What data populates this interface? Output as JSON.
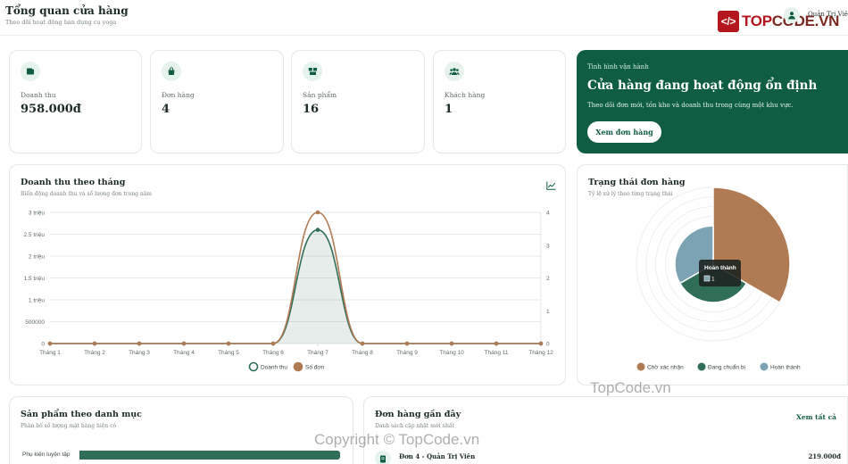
{
  "header": {
    "title": "Tổng quan cửa hàng",
    "subtitle": "Theo dõi hoạt động bán dụng cụ yoga",
    "user_name": "Quản Trị Viên"
  },
  "logo": {
    "top": "TOP",
    "code": "CODE",
    "vn": ".VN"
  },
  "stats": [
    {
      "label": "Doanh thu",
      "value": "958.000đ",
      "icon": "wallet-icon"
    },
    {
      "label": "Đơn hàng",
      "value": "4",
      "icon": "shopping-bag-icon"
    },
    {
      "label": "Sản phẩm",
      "value": "16",
      "icon": "boxes-icon"
    },
    {
      "label": "Khách hàng",
      "value": "1",
      "icon": "users-icon"
    }
  ],
  "banner": {
    "kicker": "Tình hình vận hành",
    "title": "Cửa hàng đang hoạt động ổn định",
    "description": "Theo dõi đơn mới, tồn kho và doanh thu trong cùng một khu vực.",
    "button": "Xem đơn hàng"
  },
  "revenue_panel": {
    "title": "Doanh thu theo tháng",
    "subtitle": "Biến động doanh thu và số lượng đơn trong năm"
  },
  "status_panel": {
    "title": "Trạng thái đơn hàng",
    "subtitle": "Tỷ lệ xử lý theo từng trạng thái",
    "tooltip_title": "Hoàn thành",
    "tooltip_value": "1"
  },
  "category_panel": {
    "title": "Sản phẩm theo danh mục",
    "subtitle": "Phân bố số lượng mặt hàng hiện có",
    "rows": [
      {
        "label": "Phụ kiện luyện tập",
        "fraction": 1.0
      }
    ]
  },
  "orders_panel": {
    "title": "Đơn hàng gần đây",
    "subtitle": "Danh sách cập nhật mới nhất",
    "view_all": "Xem tất cả",
    "orders": [
      {
        "name": "Đơn 4 - Quản Trị Viên",
        "total": "219.000đ"
      }
    ]
  },
  "watermarks": {
    "site": "TopCode.vn",
    "copyright": "Copyright © TopCode.vn"
  },
  "colors": {
    "primary": "#0f5d42",
    "revenue": "#2f6e57",
    "orders": "#b07a52",
    "pending": "#b07a52",
    "preparing": "#2f6e57",
    "done": "#7ba3b3"
  },
  "chart_data": [
    {
      "type": "line",
      "categories": [
        "Tháng 1",
        "Tháng 2",
        "Tháng 3",
        "Tháng 4",
        "Tháng 5",
        "Tháng 6",
        "Tháng 7",
        "Tháng 8",
        "Tháng 9",
        "Tháng 10",
        "Tháng 11",
        "Tháng 12"
      ],
      "series": [
        {
          "name": "Doanh thu",
          "axis": "left",
          "fill": true,
          "values": [
            0,
            0,
            0,
            0,
            0,
            0,
            2600000,
            0,
            0,
            0,
            0,
            0
          ]
        },
        {
          "name": "Số đơn",
          "axis": "right",
          "fill": false,
          "values": [
            0,
            0,
            0,
            0,
            0,
            0,
            4,
            0,
            0,
            0,
            0,
            0
          ]
        }
      ],
      "y_left": {
        "min": 0,
        "max": 3000000,
        "ticks": [
          0,
          500000,
          1000000,
          1500000,
          2000000,
          2500000,
          3000000
        ],
        "tick_labels": [
          "0",
          "500000",
          "1 triệu",
          "1.5 triệu",
          "2 triệu",
          "2.5 triệu",
          "3 triệu"
        ]
      },
      "y_right": {
        "min": 0,
        "max": 4,
        "ticks": [
          0,
          1,
          2,
          3,
          4
        ],
        "tick_labels": [
          "0",
          "1",
          "2",
          "3",
          "4"
        ]
      },
      "grid": true,
      "legend": "bottom"
    },
    {
      "type": "pie",
      "variant": "polar-area",
      "labels": [
        "Chờ xác nhận",
        "Đang chuẩn bị",
        "Hoàn thành"
      ],
      "values": [
        2,
        1,
        1
      ],
      "grid": true,
      "legend": "bottom"
    }
  ]
}
